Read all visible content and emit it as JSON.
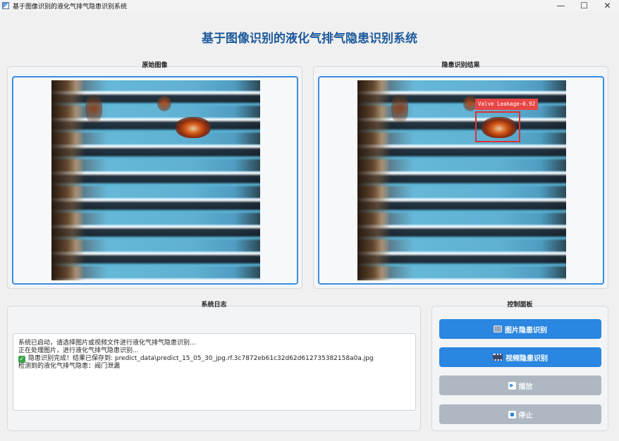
{
  "window": {
    "title": "基于图像识别的液化气排气隐患识别系统",
    "controls": {
      "minimize": "—",
      "maximize": "☐",
      "close": "✕"
    }
  },
  "app": {
    "heading": "基于图像识别的液化气排气隐患识别系统"
  },
  "panels": {
    "original": {
      "title": "原始图像"
    },
    "result": {
      "title": "隐患识别结果"
    },
    "log": {
      "title": "系统日志"
    },
    "control": {
      "title": "控制面板"
    }
  },
  "detection": {
    "label": "Valve Leakage",
    "confidence": "0.92",
    "display": "Valve Leakage~0.92",
    "box_color": "#e03030"
  },
  "log": {
    "lines": [
      "系统已启动，请选择图片或视频文件进行液化气排气隐患识别...",
      "正在处理图片，进行液化气排气隐患识别...",
      "隐患识别完成！结果已保存到: predict_data\\predict_15_05_30_jpg.rf.3c7872eb61c32d62d612735382158a0a.jpg",
      "检测到的液化气排气隐患：阀门泄漏"
    ]
  },
  "controls": {
    "image_detect": "图片隐患识别",
    "video_detect": "视频隐患识别",
    "play": "播放",
    "stop": "停止"
  },
  "colors": {
    "accent": "#2a86e0",
    "title": "#1d5a9c",
    "frame_border": "#3a8ee0",
    "disabled": "#aeb8c2"
  }
}
